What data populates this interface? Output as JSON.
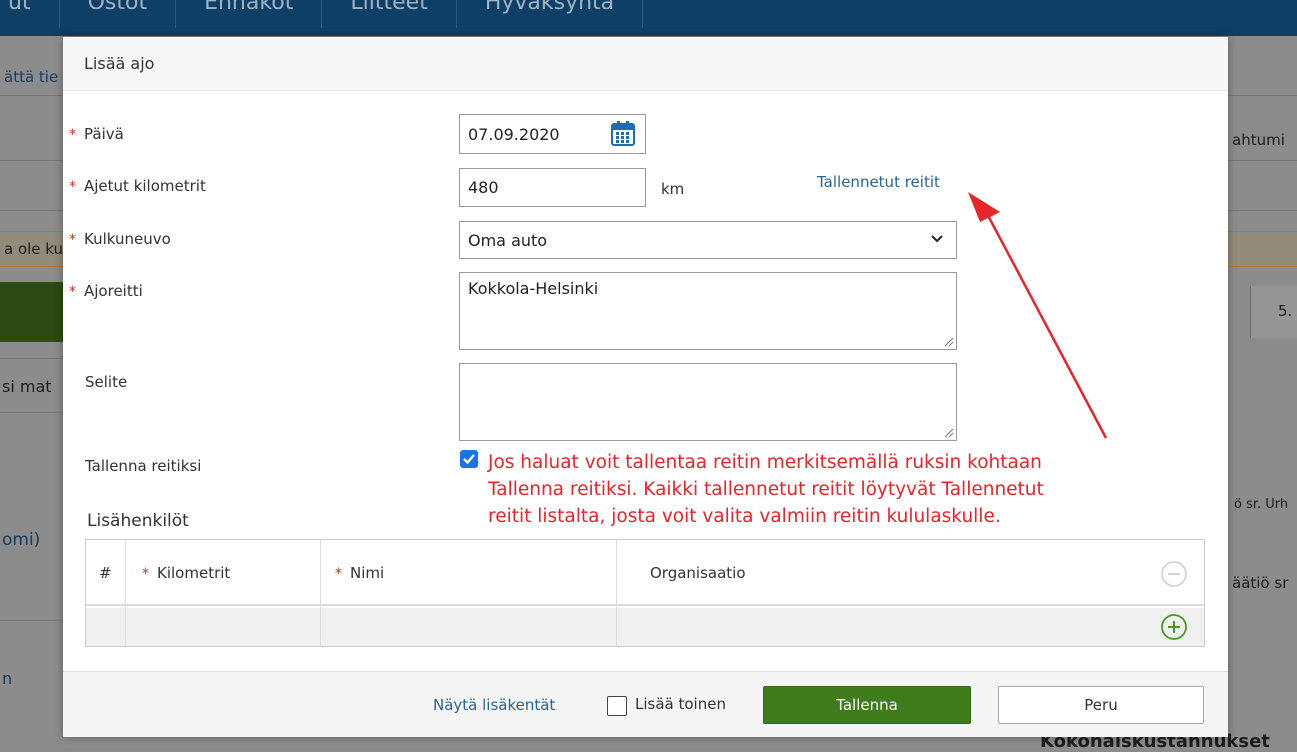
{
  "background": {
    "nav_items": [
      "ut",
      "Ostot",
      "Ennakot",
      "Liitteet",
      "Hyväksyntä"
    ],
    "left_texts": [
      "ättä tie",
      "a ole ku",
      "si mat",
      "omi)",
      "n"
    ],
    "right_texts": [
      "ahtumi",
      "5.",
      "ö sr. Urh",
      "äätiö sr"
    ],
    "bottom_right": "Kokonaiskustannukset"
  },
  "modal": {
    "title": "Lisää ajo",
    "fields": {
      "date": {
        "label": "Päivä",
        "value": "07.09.2020",
        "icon": "calendar-icon"
      },
      "km": {
        "label": "Ajetut kilometrit",
        "value": "480",
        "unit": "km"
      },
      "vehicle": {
        "label": "Kulkuneuvo",
        "value": "Oma auto"
      },
      "route": {
        "label": "Ajoreitti",
        "value": "Kokkola-Helsinki"
      },
      "description": {
        "label": "Selite",
        "value": ""
      },
      "save_route": {
        "label": "Tallenna reitiksi",
        "checked": true
      }
    },
    "saved_routes_link": "Tallennetut reitit",
    "annotation": [
      "Jos haluat voit tallentaa reitin merkitsemällä ruksin kohtaan",
      "Tallenna reitiksi. Kaikki tallennetut reitit löytyvät Tallennetut",
      "reitit listalta, josta voit valita valmiin reitin kululaskulle."
    ],
    "extra_persons": {
      "title": "Lisähenkilöt",
      "columns": [
        "#",
        "Kilometrit",
        "Nimi",
        "Organisaatio"
      ]
    },
    "footer": {
      "show_more_link": "Näytä lisäkentät",
      "add_another_label": "Lisää toinen",
      "save_button": "Tallenna",
      "cancel_button": "Peru"
    }
  },
  "colors": {
    "primary_green": "#3f7d1c",
    "link_blue": "#2a6496",
    "annotation_red": "#e8252a",
    "required_red": "#c9302c",
    "checkbox_blue": "#1a73e8"
  }
}
